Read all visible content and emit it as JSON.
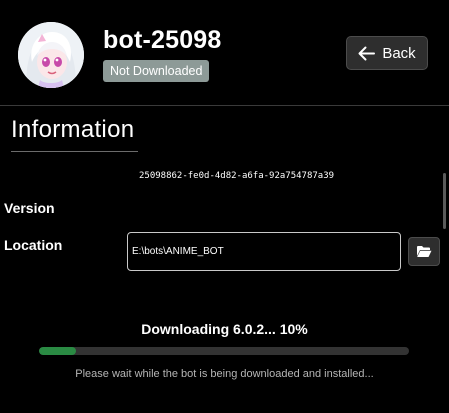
{
  "header": {
    "bot_name": "bot-25098",
    "status": "Not Downloaded",
    "back_label": "Back",
    "avatar_icon": "anime-girl-avatar"
  },
  "info": {
    "title": "Information",
    "bot_id": "25098862-fe0d-4d82-a6fa-92a754787a39",
    "version_label": "Version",
    "location_label": "Location",
    "location_value": "E:\\bots\\ANIME_BOT",
    "folder_icon": "folder-open-icon"
  },
  "progress": {
    "text": "Downloading 6.0.2... 10%",
    "percent": 10,
    "message": "Please wait while the bot is being downloaded and installed..."
  },
  "colors": {
    "background": "#000000",
    "badge": "#8d9a97",
    "button": "#2e2e2e",
    "progress_fill": "#2a8a43",
    "progress_track": "#333333"
  }
}
